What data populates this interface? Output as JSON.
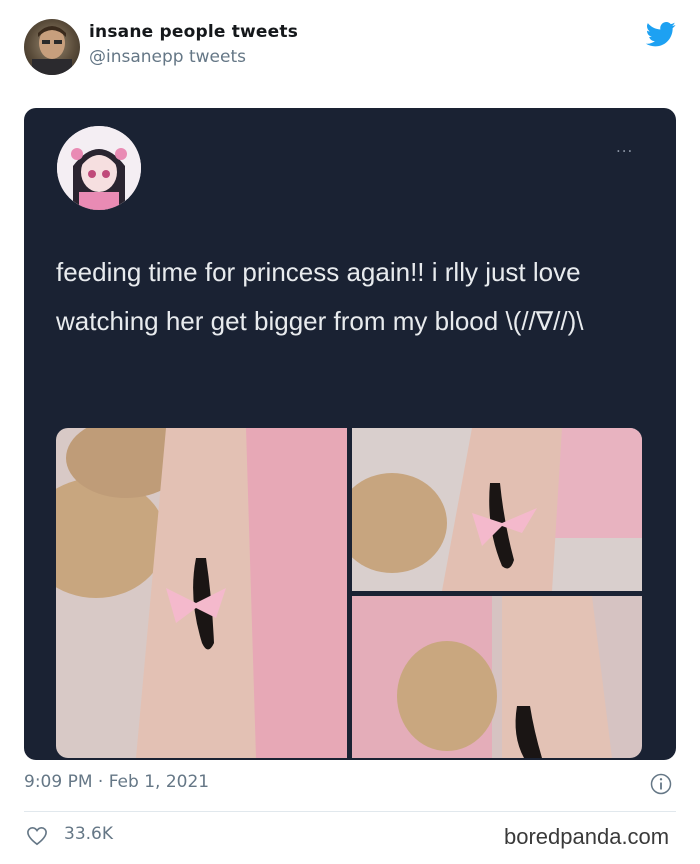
{
  "author": {
    "name": "insane people tweets",
    "handle": "@insanepp tweets",
    "avatar_icon": "profile-photo"
  },
  "brand_icon": "twitter-bird-icon",
  "brand_color": "#1da1f2",
  "embedded_tweet": {
    "more_label": "...",
    "text": "feeding time for princess again!! i rlly just love watching her get bigger from my blood \\(//∇//)\\",
    "avatar_icon": "anime-girl-avatar",
    "photos": [
      "arm-with-leech-bow-1",
      "arm-with-leech-bow-2",
      "arm-with-leech-bow-3"
    ]
  },
  "timestamp": "9:09 PM · Feb 1, 2021",
  "likes": "33.6K",
  "watermark": "boredpanda.com"
}
